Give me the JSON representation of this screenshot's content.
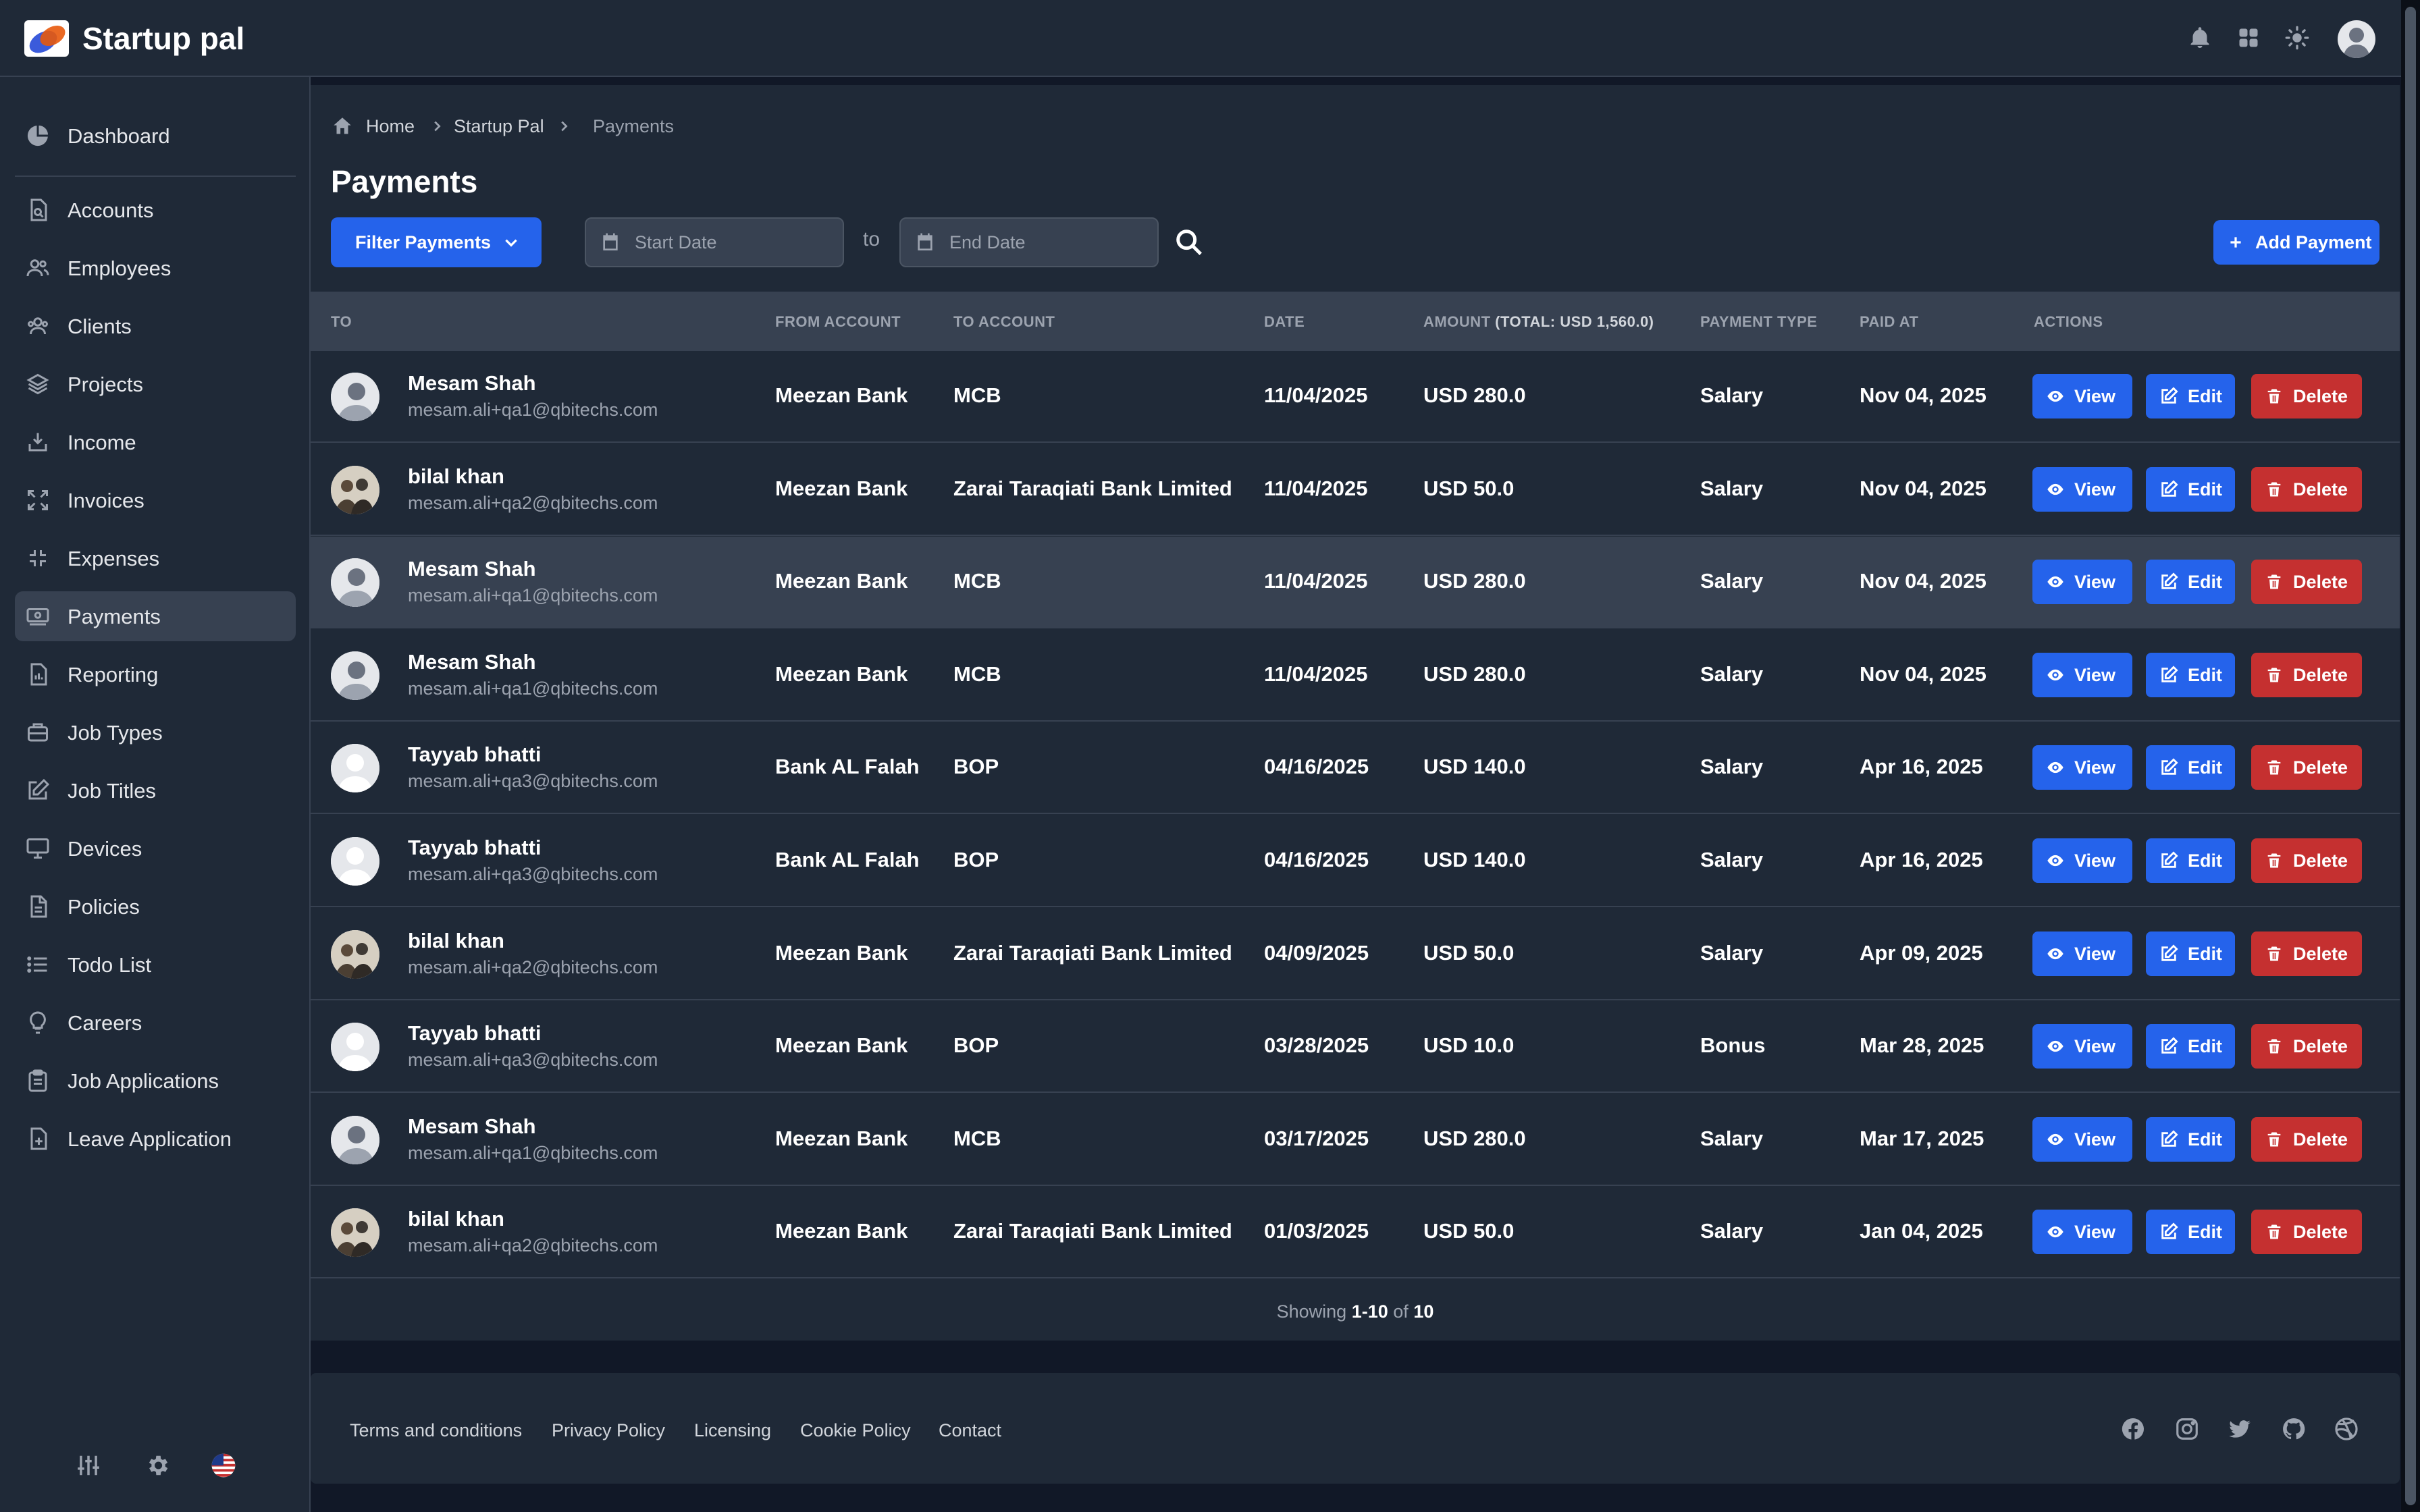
{
  "app": {
    "brand": "Startup pal"
  },
  "sidebar": {
    "items": [
      {
        "label": "Dashboard",
        "icon": "pie-chart-icon"
      },
      {
        "label": "Accounts",
        "icon": "document-search-icon"
      },
      {
        "label": "Employees",
        "icon": "users-icon"
      },
      {
        "label": "Clients",
        "icon": "user-group-icon"
      },
      {
        "label": "Projects",
        "icon": "layers-icon"
      },
      {
        "label": "Income",
        "icon": "inbox-in-icon"
      },
      {
        "label": "Invoices",
        "icon": "expand-icon"
      },
      {
        "label": "Expenses",
        "icon": "collapse-icon"
      },
      {
        "label": "Payments",
        "icon": "cash-icon",
        "active": true
      },
      {
        "label": "Reporting",
        "icon": "document-report-icon"
      },
      {
        "label": "Job Types",
        "icon": "briefcase-icon"
      },
      {
        "label": "Job Titles",
        "icon": "pencil-square-icon"
      },
      {
        "label": "Devices",
        "icon": "desktop-icon"
      },
      {
        "label": "Policies",
        "icon": "document-icon"
      },
      {
        "label": "Todo List",
        "icon": "list-icon"
      },
      {
        "label": "Careers",
        "icon": "lightbulb-icon"
      },
      {
        "label": "Job Applications",
        "icon": "clipboard-icon"
      },
      {
        "label": "Leave Application",
        "icon": "document-plus-icon"
      }
    ]
  },
  "breadcrumb": {
    "home": "Home",
    "parent": "Startup Pal",
    "current": "Payments"
  },
  "page": {
    "title": "Payments"
  },
  "toolbar": {
    "filter_label": "Filter Payments",
    "start_placeholder": "Start Date",
    "to_label": "to",
    "end_placeholder": "End Date",
    "add_label": "Add Payment"
  },
  "table": {
    "headers": {
      "to": "TO",
      "from_account": "FROM ACCOUNT",
      "to_account": "TO ACCOUNT",
      "date": "DATE",
      "amount": "AMOUNT",
      "amount_total": "(TOTAL: USD 1,560.0)",
      "payment_type": "PAYMENT TYPE",
      "paid_at": "PAID AT",
      "actions": "ACTIONS"
    },
    "actions": {
      "view": "View",
      "edit": "Edit",
      "delete": "Delete"
    },
    "rows": [
      {
        "name": "Mesam Shah",
        "email": "mesam.ali+qa1@qbitechs.com",
        "from": "Meezan Bank",
        "to": "MCB",
        "date": "11/04/2025",
        "amount": "USD 280.0",
        "type": "Salary",
        "paid": "Nov 04, 2025",
        "avatar": "photo"
      },
      {
        "name": "bilal khan",
        "email": "mesam.ali+qa2@qbitechs.com",
        "from": "Meezan Bank",
        "to": "Zarai Taraqiati Bank Limited",
        "date": "11/04/2025",
        "amount": "USD 50.0",
        "type": "Salary",
        "paid": "Nov 04, 2025",
        "avatar": "group"
      },
      {
        "name": "Mesam Shah",
        "email": "mesam.ali+qa1@qbitechs.com",
        "from": "Meezan Bank",
        "to": "MCB",
        "date": "11/04/2025",
        "amount": "USD 280.0",
        "type": "Salary",
        "paid": "Nov 04, 2025",
        "avatar": "photo",
        "highlight": true
      },
      {
        "name": "Mesam Shah",
        "email": "mesam.ali+qa1@qbitechs.com",
        "from": "Meezan Bank",
        "to": "MCB",
        "date": "11/04/2025",
        "amount": "USD 280.0",
        "type": "Salary",
        "paid": "Nov 04, 2025",
        "avatar": "photo"
      },
      {
        "name": "Tayyab bhatti",
        "email": "mesam.ali+qa3@qbitechs.com",
        "from": "Bank AL Falah",
        "to": "BOP",
        "date": "04/16/2025",
        "amount": "USD 140.0",
        "type": "Salary",
        "paid": "Apr 16, 2025",
        "avatar": "default"
      },
      {
        "name": "Tayyab bhatti",
        "email": "mesam.ali+qa3@qbitechs.com",
        "from": "Bank AL Falah",
        "to": "BOP",
        "date": "04/16/2025",
        "amount": "USD 140.0",
        "type": "Salary",
        "paid": "Apr 16, 2025",
        "avatar": "default"
      },
      {
        "name": "bilal khan",
        "email": "mesam.ali+qa2@qbitechs.com",
        "from": "Meezan Bank",
        "to": "Zarai Taraqiati Bank Limited",
        "date": "04/09/2025",
        "amount": "USD 50.0",
        "type": "Salary",
        "paid": "Apr 09, 2025",
        "avatar": "group"
      },
      {
        "name": "Tayyab bhatti",
        "email": "mesam.ali+qa3@qbitechs.com",
        "from": "Meezan Bank",
        "to": "BOP",
        "date": "03/28/2025",
        "amount": "USD 10.0",
        "type": "Bonus",
        "paid": "Mar 28, 2025",
        "avatar": "default"
      },
      {
        "name": "Mesam Shah",
        "email": "mesam.ali+qa1@qbitechs.com",
        "from": "Meezan Bank",
        "to": "MCB",
        "date": "03/17/2025",
        "amount": "USD 280.0",
        "type": "Salary",
        "paid": "Mar 17, 2025",
        "avatar": "photo"
      },
      {
        "name": "bilal khan",
        "email": "mesam.ali+qa2@qbitechs.com",
        "from": "Meezan Bank",
        "to": "Zarai Taraqiati Bank Limited",
        "date": "01/03/2025",
        "amount": "USD 50.0",
        "type": "Salary",
        "paid": "Jan 04, 2025",
        "avatar": "group"
      }
    ]
  },
  "pagination": {
    "prefix": "Showing",
    "range": "1-10",
    "of": "of",
    "total": "10"
  },
  "footer": {
    "links": [
      "Terms and conditions",
      "Privacy Policy",
      "Licensing",
      "Cookie Policy",
      "Contact"
    ],
    "social": [
      "facebook-icon",
      "instagram-icon",
      "twitter-icon",
      "github-icon",
      "dribbble-icon"
    ]
  },
  "colors": {
    "accent": "#2563eb",
    "danger": "#c53030",
    "bg": "#111827",
    "panel": "#1f2937"
  }
}
